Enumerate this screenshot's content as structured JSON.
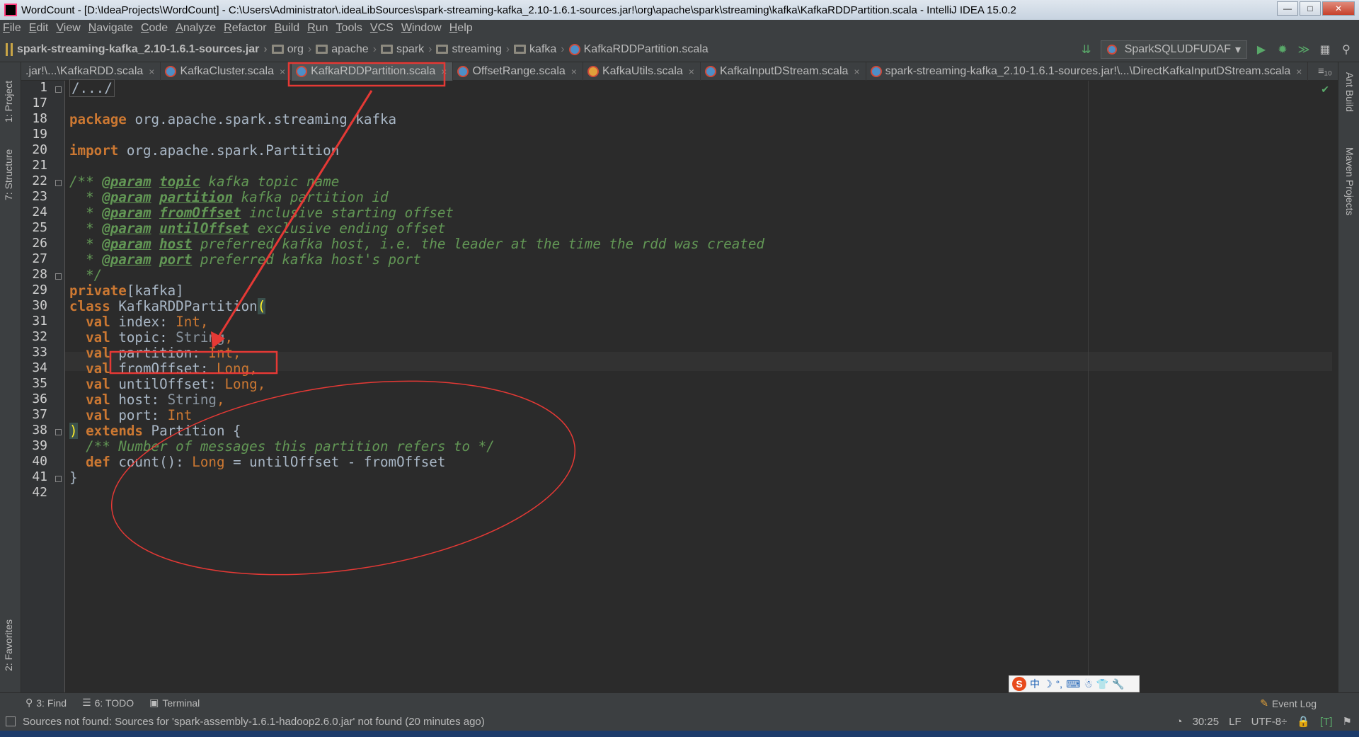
{
  "window": {
    "title": "WordCount - [D:\\IdeaProjects\\WordCount] - C:\\Users\\Administrator\\.ideaLibSources\\spark-streaming-kafka_2.10-1.6.1-sources.jar!\\org\\apache\\spark\\streaming\\kafka\\KafkaRDDPartition.scala - IntelliJ IDEA 15.0.2",
    "minimize": "—",
    "maximize": "□",
    "close": "✕"
  },
  "menu": [
    "File",
    "Edit",
    "View",
    "Navigate",
    "Code",
    "Analyze",
    "Refactor",
    "Build",
    "Run",
    "Tools",
    "VCS",
    "Window",
    "Help"
  ],
  "breadcrumb": {
    "jar": "spark-streaming-kafka_2.10-1.6.1-sources.jar",
    "folders": [
      "org",
      "apache",
      "spark",
      "streaming",
      "kafka"
    ],
    "file": "KafkaRDDPartition.scala"
  },
  "toolbar": {
    "run_config": "SparkSQLUDFUDAF"
  },
  "tabs": [
    {
      "label": ".jar!\\...\\KafkaRDD.scala",
      "active": false
    },
    {
      "label": "KafkaCluster.scala",
      "active": false
    },
    {
      "label": "KafkaRDDPartition.scala",
      "active": true
    },
    {
      "label": "OffsetRange.scala",
      "active": false
    },
    {
      "label": "KafkaUtils.scala",
      "active": false
    },
    {
      "label": "KafkaInputDStream.scala",
      "active": false
    },
    {
      "label": "spark-streaming-kafka_2.10-1.6.1-sources.jar!\\...\\DirectKafkaInputDStream.scala",
      "active": false
    }
  ],
  "tab_overflow": "≡₁₀",
  "left_tools": {
    "project": "1: Project",
    "structure": "7: Structure",
    "favorites": "2: Favorites"
  },
  "right_tools": {
    "ant": "Ant Build",
    "maven": "Maven Projects"
  },
  "code": {
    "line_numbers": [
      "1",
      "17",
      "18",
      "19",
      "20",
      "21",
      "22",
      "23",
      "24",
      "25",
      "26",
      "27",
      "28",
      "29",
      "30",
      "31",
      "32",
      "33",
      "34",
      "35",
      "36",
      "37",
      "38",
      "39",
      "40",
      "41",
      "42"
    ],
    "collapsed_header": "/.../",
    "package_kw": "package",
    "package_name": "org.apache.spark.streaming.kafka",
    "import_kw": "import",
    "import_name": "org.apache.spark.Partition",
    "doc_lines": [
      {
        "prefix": "/** ",
        "tag": "@param",
        "name": "topic",
        "text": " kafka topic name"
      },
      {
        "prefix": "  * ",
        "tag": "@param",
        "name": "partition",
        "text": " kafka partition id"
      },
      {
        "prefix": "  * ",
        "tag": "@param",
        "name": "fromOffset",
        "text": " inclusive starting offset"
      },
      {
        "prefix": "  * ",
        "tag": "@param",
        "name": "untilOffset",
        "text": " exclusive ending offset"
      },
      {
        "prefix": "  * ",
        "tag": "@param",
        "name": "host",
        "text": " preferred kafka host, i.e. the leader at the time the rdd was created"
      },
      {
        "prefix": "  * ",
        "tag": "@param",
        "name": "port",
        "text": " preferred kafka host's port"
      }
    ],
    "doc_end": "  */",
    "private_kw": "private",
    "private_scope": "[kafka]",
    "class_kw": "class",
    "class_name": " KafkaRDDPartition",
    "open_paren": "(",
    "params": [
      {
        "name": " index: ",
        "type": "Int",
        "end": ","
      },
      {
        "name": " topic: ",
        "type": "String",
        "end": ","
      },
      {
        "name": " partition: ",
        "type": "Int",
        "end": ","
      },
      {
        "name": " fromOffset: ",
        "type": "Long",
        "end": ","
      },
      {
        "name": " untilOffset: ",
        "type": "Long",
        "end": ","
      },
      {
        "name": " host: ",
        "type": "String",
        "end": ","
      },
      {
        "name": " port: ",
        "type": "Int",
        "end": ""
      }
    ],
    "val_kw": "val",
    "close_paren": ")",
    "extends_kw": " extends",
    "extends_name": " Partition {",
    "method_doc": "  /** Number of messages this partition refers to */",
    "def_kw": "def",
    "def_name": " count",
    "def_parens": "(): ",
    "def_type": "Long",
    "def_body": " = untilOffset - fromOffset",
    "close_brace": "}"
  },
  "bottom_tools": {
    "find": "3: Find",
    "todo": "6: TODO",
    "terminal": "Terminal",
    "event_log": "Event Log"
  },
  "status": {
    "message": "Sources not found: Sources for 'spark-assembly-1.6.1-hadoop2.6.0.jar' not found (20 minutes ago)",
    "position": "30:25",
    "line_sep": "LF",
    "encoding": "UTF-8÷"
  },
  "ime": {
    "lang": "中"
  },
  "colors": {
    "keyword": "#cc7832",
    "doc": "#629755",
    "annotation": "#e53935"
  }
}
